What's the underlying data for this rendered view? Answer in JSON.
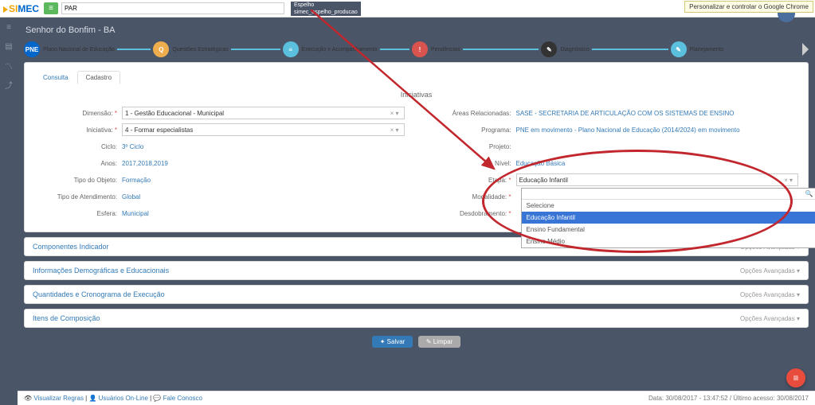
{
  "chrome_tip": "Personalizar e controlar o Google Chrome",
  "logo": {
    "a": "SI",
    "b": "MEC"
  },
  "top_select": "PAR",
  "top_menu": {
    "line1": "Espelho",
    "line2": "simec_espelho_producao"
  },
  "page_title": "Senhor do Bonfim - BA",
  "wizard": [
    {
      "label": "Plano Nacional de Educação",
      "cls": "c1",
      "txt": "PNE"
    },
    {
      "label": "Questões Estratégicas",
      "cls": "c2",
      "txt": "Q"
    },
    {
      "label": "Execução e Acompanhamento",
      "cls": "c3",
      "txt": "≡"
    },
    {
      "label": "Pendências",
      "cls": "c4",
      "txt": "!"
    },
    {
      "label": "Diagnóstico",
      "cls": "c5",
      "txt": "✎"
    },
    {
      "label": "Planejamento",
      "cls": "c6",
      "txt": "✎"
    }
  ],
  "tabs": {
    "consulta": "Consulta",
    "cadastro": "Cadastro"
  },
  "section_title": "Iniciativas",
  "left": {
    "dimensao": {
      "label": "Dimensão:",
      "val": "1 - Gestão Educacional - Municipal"
    },
    "iniciativa": {
      "label": "Iniciativa:",
      "val": "4 - Formar especialistas"
    },
    "ciclo": {
      "label": "Ciclo:",
      "val": "3º Ciclo"
    },
    "anos": {
      "label": "Anos:",
      "val": "2017,2018,2019"
    },
    "tipo_objeto": {
      "label": "Tipo do Objeto:",
      "val": "Formação"
    },
    "tipo_atend": {
      "label": "Tipo de Atendimento:",
      "val": "Global"
    },
    "esfera": {
      "label": "Esfera:",
      "val": "Municipal"
    }
  },
  "right": {
    "areas": {
      "label": "Áreas Relacionadas:",
      "val": "SASE - SECRETARIA DE ARTICULAÇÃO COM OS SISTEMAS DE ENSINO"
    },
    "programa": {
      "label": "Programa:",
      "val": "PNE em movimento - Plano Nacional de Educação (2014/2024) em movimento"
    },
    "projeto": {
      "label": "Projeto:",
      "val": ""
    },
    "nivel": {
      "label": "Nível:",
      "val": "Educação Básica"
    },
    "etapa": {
      "label": "Etapa:",
      "val": "Educação Infantil"
    },
    "modalidade": {
      "label": "Modalidade:"
    },
    "desdobramento": {
      "label": "Desdobramento:"
    }
  },
  "dropdown": {
    "placeholder": "",
    "opts": [
      "Selecione",
      "Educação Infantil",
      "Ensino Fundamental",
      "Ensino Médio"
    ]
  },
  "collapse": [
    "Componentes Indicador",
    "Informações Demográficas e Educacionais",
    "Quantidades e Cronograma de Execução",
    "Itens de Composição"
  ],
  "collapse_opt": "Opções Avançadas ▾",
  "buttons": {
    "save": "✦ Salvar",
    "clear": "✎ Limpar"
  },
  "footer": {
    "links": [
      "Visualizar Regras",
      "Usuários On-Line",
      "Fale Conosco"
    ],
    "right": "Data: 30/08/2017 - 13:47:52 / Último acesso: 30/08/2017"
  }
}
